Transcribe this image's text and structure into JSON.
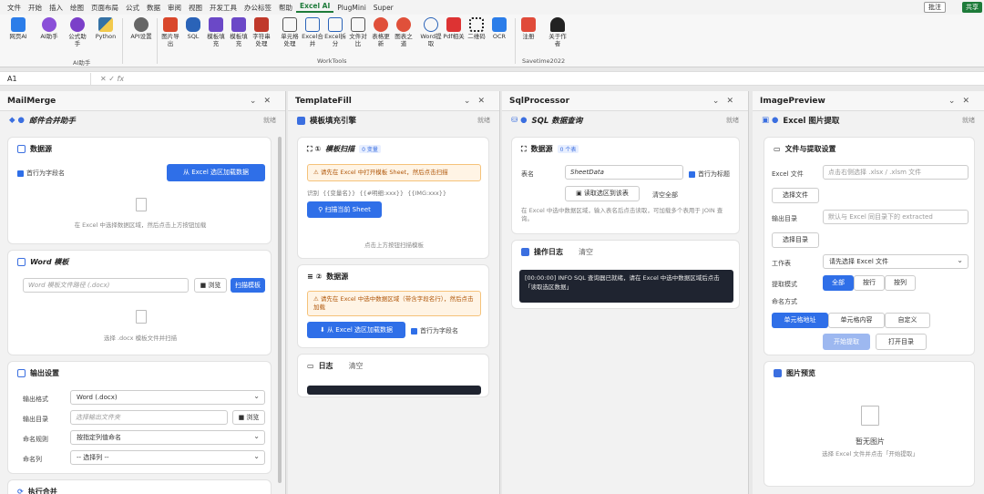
{
  "menu": {
    "items": [
      "文件",
      "开始",
      "插入",
      "绘图",
      "页面布局",
      "公式",
      "数据",
      "审阅",
      "视图",
      "开发工具",
      "办公标签",
      "帮助",
      "Excel AI",
      "PlugMini",
      "Super"
    ],
    "comment": "批注",
    "share": "共享"
  },
  "ribbon": {
    "buttons": [
      "网页AI",
      "AI助手",
      "公式助手",
      "Python",
      "API设置",
      "图片导出",
      "SQL",
      "模板填充",
      "模板填充",
      "字符串处理",
      "单元格处理",
      "Excel合并",
      "Excel拆分",
      "文件对比",
      "表格更新",
      "图表之道",
      "Word提取",
      "Pdf相关",
      "二维码",
      "OCR",
      "注册",
      "关于作者"
    ],
    "groups": {
      "ai": "AI助手",
      "worktools": "WorkTools",
      "savetime": "Savetime2022"
    }
  },
  "formula": {
    "cell": "A1",
    "fx": "fx"
  },
  "mailmerge": {
    "panel": "MailMerge",
    "title": "邮件合并助手",
    "status": "就绪",
    "ds_title": "数据源",
    "first_row": "首行为字段名",
    "load_btn": "从 Excel 选区加载数据",
    "ds_hint": "在 Excel 中选择数据区域，然后点击上方按钮加载",
    "word_title": "Word 模板",
    "word_ph": "Word 模板文件路径 (.docx)",
    "browse": "浏览",
    "scan": "扫描模板",
    "word_hint": "选择 .docx 模板文件并扫描",
    "out_title": "输出设置",
    "fmt_label": "输出格式",
    "fmt_val": "Word (.docx)",
    "dir_label": "输出目录",
    "dir_ph": "选择输出文件夹",
    "browse2": "浏览",
    "rule_label": "命名规则",
    "rule_val": "按指定列值命名",
    "col_label": "命名列",
    "col_val": "-- 选择列 --",
    "exec_title": "执行合并"
  },
  "templatefill": {
    "panel": "TemplateFill",
    "title": "模板填充引擎",
    "status": "就绪",
    "scan_title": "模板扫描",
    "scan_tag": "0 变量",
    "warn1": "请先在 Excel 中打开模板 Sheet，然后点击扫描",
    "ident": "识别",
    "t1": "{{变量名}}",
    "t2": "{{#明细:xxx}}",
    "t3": "{{IMG:xxx}}",
    "scan_btn": "扫描当前 Sheet",
    "scan_hint": "点击上方按钮扫描模板",
    "ds_title": "数据源",
    "warn2": "请先在 Excel 中选中数据区域（带含字段名行），然后点击加载",
    "load_btn": "从 Excel 选区加载数据",
    "first_row": "首行为字段名",
    "log_title": "日志",
    "clear": "清空"
  },
  "sql": {
    "panel": "SqlProcessor",
    "title": "SQL 数据查询",
    "status": "就绪",
    "ds_title": "数据源",
    "ds_tag": "0 个表",
    "tbl_label": "表名",
    "tbl_val": "SheetData",
    "first_row": "首行为标题",
    "read_btn": "读取选区到该表",
    "clear_all": "清空全部",
    "hint": "在 Excel 中选中数据区域，输入表名后点击读取，可加载多个表用于 JOIN 查询。",
    "log_title": "操作日志",
    "log_clear": "清空",
    "log_line": "[00:00:00] INFO SQL 查询器已就绪，请在 Excel 中选中数据区域后点击「读取选区数据」"
  },
  "image": {
    "panel": "ImagePreview",
    "title": "Excel 图片提取",
    "status": "就绪",
    "set_title": "文件与提取设置",
    "file_label": "Excel 文件",
    "file_ph": "点击右侧选择 .xlsx / .xlsm 文件",
    "choose_file": "选择文件",
    "out_label": "输出目录",
    "out_ph": "默认与 Excel 同目录下的 extracted",
    "choose_dir": "选择目录",
    "sheet_label": "工作表",
    "sheet_val": "请先选择 Excel 文件",
    "mode_label": "提取模式",
    "modes": [
      "全部",
      "按行",
      "按列"
    ],
    "name_label": "命名方式",
    "names": [
      "单元格地址",
      "单元格内容",
      "自定义"
    ],
    "start": "开始提取",
    "open_dir": "打开目录",
    "prev_title": "图片预览",
    "empty": "暂无图片",
    "empty_hint": "选择 Excel 文件并点击「开始提取」"
  }
}
